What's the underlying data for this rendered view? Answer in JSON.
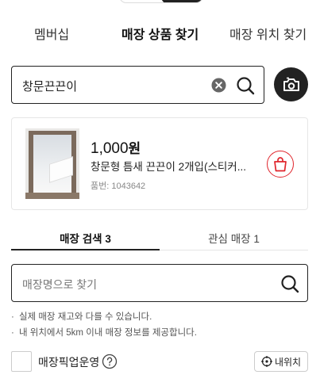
{
  "tabs": [
    {
      "label": "멤버십",
      "active": false
    },
    {
      "label": "매장 상품 찾기",
      "active": true
    },
    {
      "label": "매장 위치 찾기",
      "active": false
    }
  ],
  "search": {
    "value": "창문끈끈이",
    "icons": [
      "clear-icon",
      "search-icon",
      "camera-icon"
    ]
  },
  "product": {
    "price_number": "1,000",
    "price_unit": "원",
    "name": "창문형 틈새 끈끈이 2개입(스티커...",
    "code": "품번: 1043642",
    "icon": "shopping-bag-icon",
    "accent": "#e0252c"
  },
  "subtabs": [
    {
      "label": "매장 검색 3",
      "active": true
    },
    {
      "label": "관심 매장 1",
      "active": false
    }
  ],
  "store_search": {
    "placeholder": "매장명으로 찾기"
  },
  "notes": [
    "실제 매장 재고와 다를 수 있습니다.",
    "내 위치에서 5km 이내 매장 정보를 제공합니다."
  ],
  "pickup": {
    "label": "매장픽업운영",
    "checked": false
  },
  "my_location": {
    "label": "내위치",
    "icon": "crosshair-icon"
  }
}
